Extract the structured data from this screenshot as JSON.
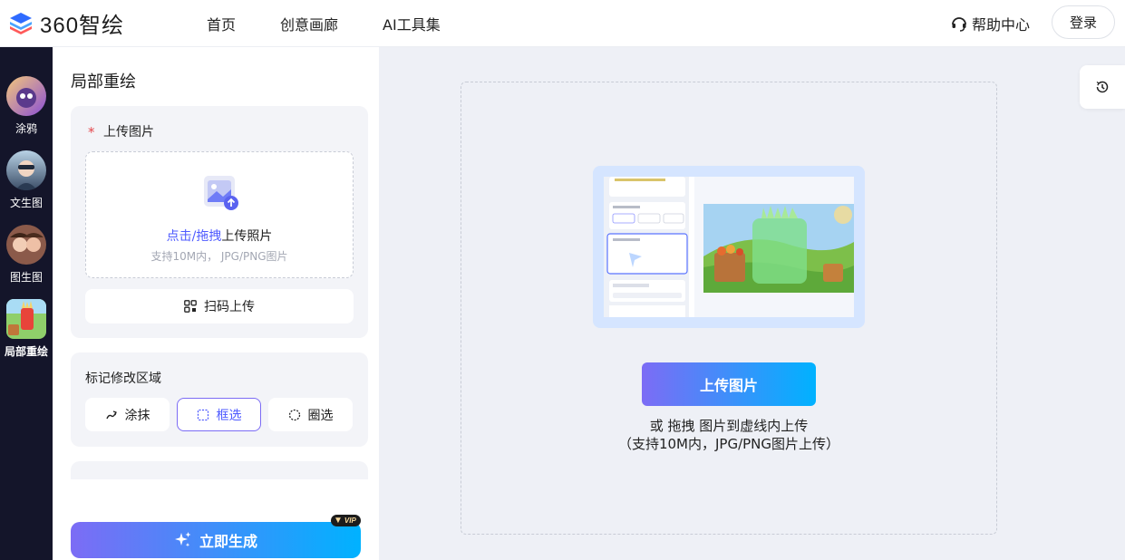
{
  "app": {
    "logo_text": "360智绘"
  },
  "nav": {
    "items": [
      "首页",
      "创意画廊",
      "AI工具集"
    ],
    "help_label": "帮助中心",
    "login_label": "登录"
  },
  "rail": {
    "items": [
      "涂鸦",
      "文生图",
      "图生图",
      "局部重绘"
    ],
    "active": "局部重绘"
  },
  "panel": {
    "title": "局部重绘",
    "upload": {
      "required_mark": "*",
      "label": "上传图片",
      "drop_highlight": "点击/拖拽",
      "drop_text": "上传照片",
      "drop_hint": "支持10M内， JPG/PNG图片",
      "qr_label": "扫码上传"
    },
    "mark": {
      "title": "标记修改区域",
      "tools": [
        "涂抹",
        "框选",
        "圈选"
      ],
      "active_tool": "框选"
    },
    "generate_label": "立即生成",
    "vip_label": "VIP"
  },
  "canvas": {
    "upload_label": "上传图片",
    "hint_line1": "或 拖拽 图片到虚线内上传",
    "hint_line2": "（支持10M内，JPG/PNG图片上传）"
  },
  "colors": {
    "accent": "#4f5bff",
    "gradient_start": "#7c6cf5",
    "gradient_end": "#00b2ff",
    "rail_bg": "#14152a"
  }
}
